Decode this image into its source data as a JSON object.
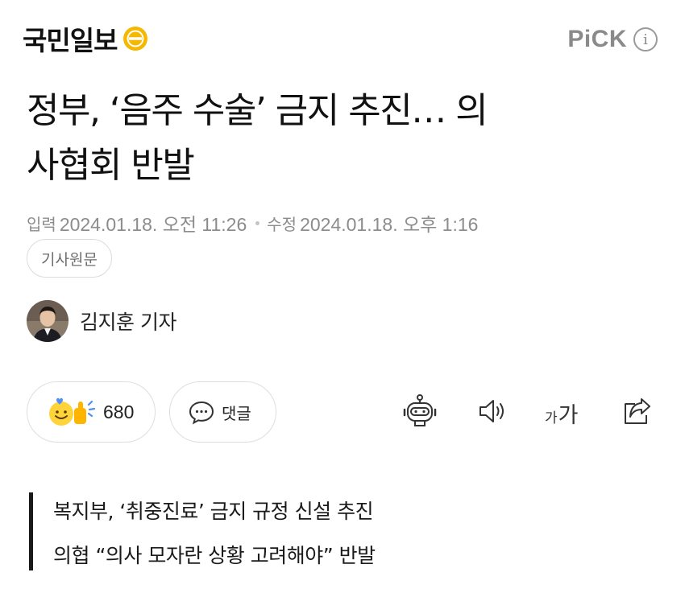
{
  "header": {
    "brand_name": "국민일보",
    "brand_icon": "kmib-logo-icon",
    "pick_label": "PiCK",
    "pick_info_glyph": "i",
    "pick_info_icon": "info-icon"
  },
  "article": {
    "headline_line1": "정부, ‘음주 수술’ 금지 추진… 의",
    "headline_line2": "사협회 반발",
    "input_label": "입력",
    "input_date": "2024.01.18. 오전 11:26",
    "modified_label": "수정",
    "modified_date": "2024.01.18. 오후 1:16",
    "original_button": "기사원문",
    "reporter": "김지훈 기자",
    "reporter_avatar_icon": "reporter-avatar"
  },
  "actions": {
    "reaction_count": "680",
    "reaction_icon": "like-emoji-icon",
    "comment_label": "댓글",
    "comment_icon": "speech-bubble-icon",
    "summary_bot_icon": "robot-icon",
    "tts_icon": "speaker-icon",
    "font_small": "가",
    "font_big": "가",
    "share_icon": "share-icon"
  },
  "subheadline": {
    "line1": "복지부, ‘취중진료’ 금지 규정 신설 추진",
    "line2": "의협 “의사 모자란 상황 고려해야” 반발"
  },
  "colors": {
    "text": "#111111",
    "muted": "#8c8c8c",
    "border": "#dedede",
    "brand_yellow": "#f5b800"
  }
}
